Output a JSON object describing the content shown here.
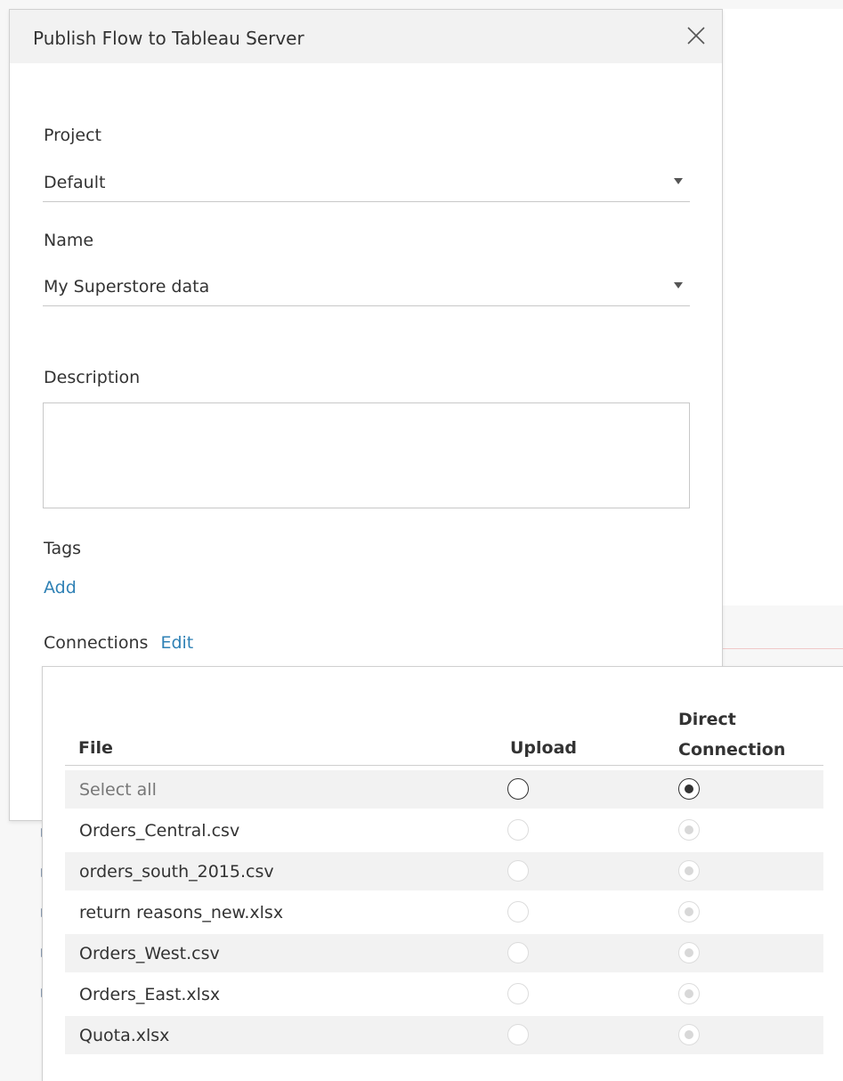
{
  "dialog": {
    "title": "Publish Flow to Tableau Server",
    "close_icon": "close-icon"
  },
  "project": {
    "label": "Project",
    "value": "Default"
  },
  "name": {
    "label": "Name",
    "value": "My Superstore data"
  },
  "description": {
    "label": "Description",
    "value": "",
    "placeholder": ""
  },
  "tags": {
    "label": "Tags",
    "add_link": "Add"
  },
  "connections": {
    "label": "Connections",
    "edit_link": "Edit",
    "headers": {
      "file": "File",
      "upload": "Upload",
      "direct_line1": "Direct",
      "direct_line2": "Connection"
    },
    "select_all": {
      "label": "Select all",
      "selected": "direct"
    },
    "rows": [
      {
        "file": "Orders_Central.csv",
        "selected": "direct"
      },
      {
        "file": "orders_south_2015.csv",
        "selected": "direct"
      },
      {
        "file": "return reasons_new.xlsx",
        "selected": "direct"
      },
      {
        "file": "Orders_West.csv",
        "selected": "direct"
      },
      {
        "file": "Orders_East.xlsx",
        "selected": "direct"
      },
      {
        "file": "Quota.xlsx",
        "selected": "direct"
      }
    ]
  },
  "colors": {
    "link": "#2f81b5",
    "header_bg": "#f2f2f2",
    "row_shade": "#f2f2f2",
    "text": "#333333"
  }
}
